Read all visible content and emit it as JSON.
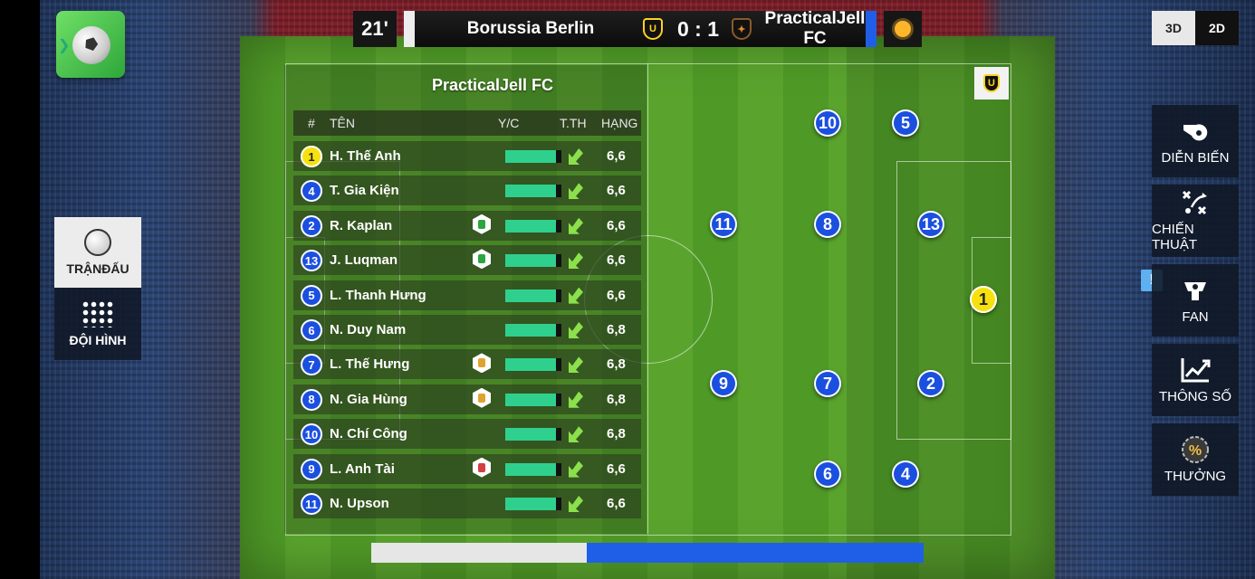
{
  "match": {
    "minute": "21'",
    "home_team": "Borussia Berlin",
    "away_team": "PracticalJell FC",
    "score": "0 : 1",
    "home_crest_letter": "U",
    "away_crest_letter": "✦",
    "weather_icon": "sun-icon",
    "possession_home_fraction": 0.39,
    "colors": {
      "home": "#eeeeee",
      "away": "#1f5fe8",
      "player": "#1b4fe0",
      "goalkeeper": "#f6e10f",
      "stamina": "#2fd08e"
    }
  },
  "view_toggle": {
    "three_d": "3D",
    "two_d": "2D"
  },
  "left_menu": [
    {
      "label": "TRẬNĐẤU",
      "icon": "ball-icon"
    },
    {
      "label": "ĐỘI HÌNH",
      "icon": "formation-icon"
    }
  ],
  "right_menu": [
    {
      "label": "DIỄN BIẾN",
      "icon": "whistle-icon"
    },
    {
      "label": "CHIẾN THUẬT",
      "icon": "tactics-icon"
    },
    {
      "label": "FAN",
      "icon": "fan-icon"
    },
    {
      "label": "THÔNG SỐ",
      "icon": "stats-chart-icon"
    },
    {
      "label": "THƯỞNG",
      "icon": "percent-icon"
    }
  ],
  "alert_badge": "!",
  "lineup": {
    "team_name": "PracticalJell FC",
    "headers": {
      "number": "#",
      "name": "TÊN",
      "stamina": "Y/C",
      "form": "T.TH",
      "rating": "HẠNG"
    },
    "players": [
      {
        "number": "1",
        "name": "H. Thế Anh",
        "badge": "",
        "stamina": 0.9,
        "rating": "6,6",
        "gk": true
      },
      {
        "number": "4",
        "name": "T. Gia Kiện",
        "badge": "",
        "stamina": 0.9,
        "rating": "6,6",
        "gk": false
      },
      {
        "number": "2",
        "name": "R. Kaplan",
        "badge": "green",
        "stamina": 0.9,
        "rating": "6,6",
        "gk": false
      },
      {
        "number": "13",
        "name": "J. Luqman",
        "badge": "green",
        "stamina": 0.9,
        "rating": "6,6",
        "gk": false
      },
      {
        "number": "5",
        "name": "L. Thanh Hưng",
        "badge": "",
        "stamina": 0.9,
        "rating": "6,6",
        "gk": false
      },
      {
        "number": "6",
        "name": "N. Duy Nam",
        "badge": "",
        "stamina": 0.9,
        "rating": "6,8",
        "gk": false
      },
      {
        "number": "7",
        "name": "L. Thế Hưng",
        "badge": "yellow",
        "stamina": 0.9,
        "rating": "6,8",
        "gk": false
      },
      {
        "number": "8",
        "name": "N. Gia Hùng",
        "badge": "yellow",
        "stamina": 0.9,
        "rating": "6,8",
        "gk": false
      },
      {
        "number": "10",
        "name": "N. Chí Công",
        "badge": "",
        "stamina": 0.9,
        "rating": "6,8",
        "gk": false
      },
      {
        "number": "9",
        "name": "L. Anh Tài",
        "badge": "red",
        "stamina": 0.9,
        "rating": "6,6",
        "gk": false
      },
      {
        "number": "11",
        "name": "N. Upson",
        "badge": "",
        "stamina": 0.9,
        "rating": "6,6",
        "gk": false
      }
    ]
  },
  "pitch_players": [
    "10",
    "5",
    "11",
    "8",
    "13",
    "1",
    "9",
    "7",
    "2",
    "6",
    "4"
  ]
}
